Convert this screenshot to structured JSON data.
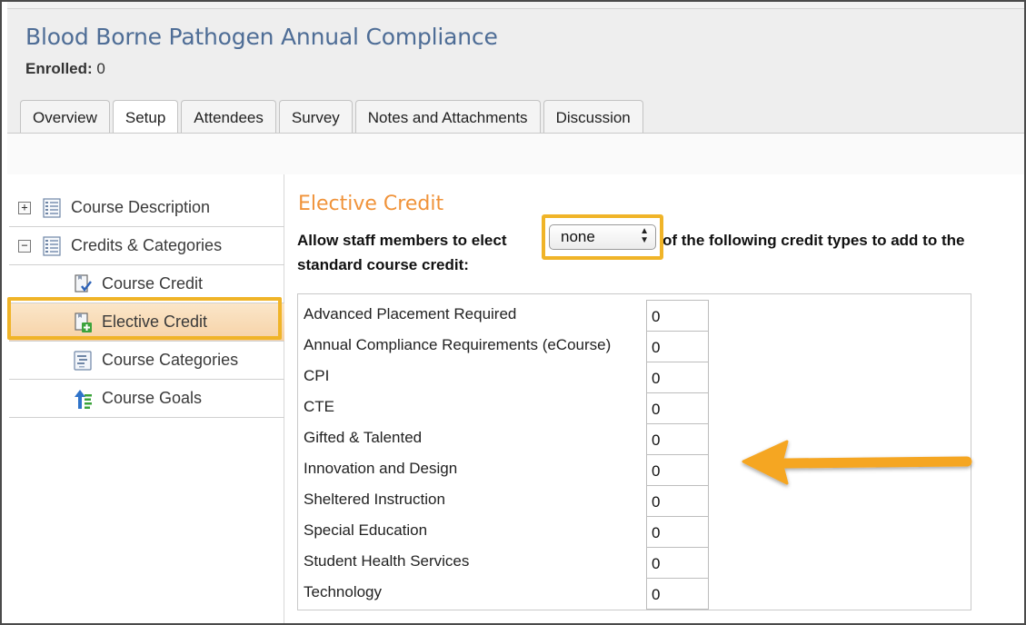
{
  "course": {
    "title": "Blood Borne Pathogen Annual Compliance",
    "enrolled_label": "Enrolled:",
    "enrolled_value": "0"
  },
  "tabs": [
    {
      "label": "Overview",
      "active": false
    },
    {
      "label": "Setup",
      "active": true
    },
    {
      "label": "Attendees",
      "active": false
    },
    {
      "label": "Survey",
      "active": false
    },
    {
      "label": "Notes and Attachments",
      "active": false
    },
    {
      "label": "Discussion",
      "active": false
    }
  ],
  "sidebar": {
    "items": [
      {
        "label": "Course Description",
        "toggle": "+",
        "icon": "document-icon"
      },
      {
        "label": "Credits & Categories",
        "toggle": "−",
        "icon": "document-icon"
      },
      {
        "label": "Course Credit",
        "icon": "credit-check-icon"
      },
      {
        "label": "Elective Credit",
        "icon": "credit-add-icon",
        "selected": true
      },
      {
        "label": "Course Categories",
        "icon": "categories-icon"
      },
      {
        "label": "Course Goals",
        "icon": "goals-icon"
      }
    ]
  },
  "main": {
    "section_title": "Elective Credit",
    "allow_text_before": "Allow staff members to elect",
    "allow_text_after": "of the following credit types to add to the",
    "allow_text_line2": "standard course credit:",
    "select_value": "none",
    "credit_types": [
      {
        "label": "Advanced Placement Required",
        "value": "0"
      },
      {
        "label": "Annual Compliance Requirements (eCourse)",
        "value": "0"
      },
      {
        "label": "CPI",
        "value": "0"
      },
      {
        "label": "CTE",
        "value": "0"
      },
      {
        "label": "Gifted & Talented",
        "value": "0"
      },
      {
        "label": "Innovation and Design",
        "value": "0"
      },
      {
        "label": "Sheltered Instruction",
        "value": "0"
      },
      {
        "label": "Special Education",
        "value": "0"
      },
      {
        "label": "Student Health Services",
        "value": "0"
      },
      {
        "label": "Technology",
        "value": "0"
      }
    ]
  },
  "colors": {
    "title_blue": "#4e6d96",
    "section_orange": "#f0933a",
    "highlight_yellow": "#f0b428",
    "arrow_orange": "#f5a623"
  }
}
